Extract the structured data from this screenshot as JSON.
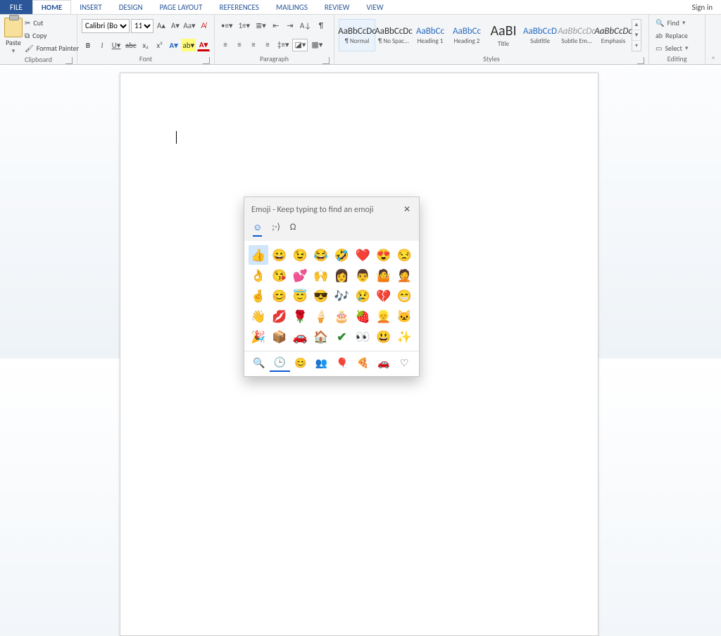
{
  "tabs": {
    "file": "FILE",
    "home": "HOME",
    "insert": "INSERT",
    "design": "DESIGN",
    "layout": "PAGE LAYOUT",
    "refs": "REFERENCES",
    "mail": "MAILINGS",
    "review": "REVIEW",
    "view": "VIEW",
    "signin": "Sign in"
  },
  "clipboard": {
    "paste": "Paste",
    "cut": "Cut",
    "copy": "Copy",
    "painter": "Format Painter",
    "group": "Clipboard"
  },
  "font": {
    "name": "Calibri (Body)",
    "size": "11",
    "group": "Font",
    "btn": {
      "bold": "B",
      "italic": "I",
      "under": "U",
      "strike": "abc",
      "sub": "x₂",
      "sup": "x²"
    }
  },
  "para": {
    "group": "Paragraph"
  },
  "styles": {
    "group": "Styles",
    "items": [
      {
        "preview": "AaBbCcDc",
        "name": "¶ Normal",
        "cls": "",
        "sel": true
      },
      {
        "preview": "AaBbCcDc",
        "name": "¶ No Spac...",
        "cls": ""
      },
      {
        "preview": "AaBbCc",
        "name": "Heading 1",
        "cls": "link"
      },
      {
        "preview": "AaBbCc",
        "name": "Heading 2",
        "cls": "link"
      },
      {
        "preview": "AaBI",
        "name": "Title",
        "cls": "title"
      },
      {
        "preview": "AaBbCcD",
        "name": "Subtitle",
        "cls": "link"
      },
      {
        "preview": "AaBbCcDc",
        "name": "Subtle Em...",
        "cls": "subtle"
      },
      {
        "preview": "AaBbCcDc",
        "name": "Emphasis",
        "cls": "emph"
      }
    ]
  },
  "editing": {
    "find": "Find",
    "replace": "Replace",
    "select": "Select",
    "group": "Editing"
  },
  "emoji": {
    "title": "Emoji - Keep typing to find an emoji",
    "tabs": {
      "smiley": "☺",
      "kaomoji": ";-)",
      "symbols": "Ω"
    },
    "grid": [
      "👍",
      "😀",
      "😉",
      "😂",
      "🤣",
      "❤️",
      "😍",
      "😒",
      "👌",
      "😘",
      "💕",
      "🙌",
      "👩",
      "👨",
      "🤷",
      "🤦",
      "🤞",
      "😊",
      "😇",
      "😎",
      "🎶",
      "😢",
      "💔",
      "😁",
      "👋",
      "💋",
      "🌹",
      "🍦",
      "🎂",
      "🍓",
      "👱",
      "🐱",
      "🎉",
      "📦",
      "🚗",
      "🏠",
      "✔",
      "👀",
      "😃",
      "✨"
    ],
    "cats": [
      "🔍",
      "🕒",
      "😊",
      "👥",
      "🎈",
      "🍕",
      "🚗",
      "♡"
    ]
  }
}
